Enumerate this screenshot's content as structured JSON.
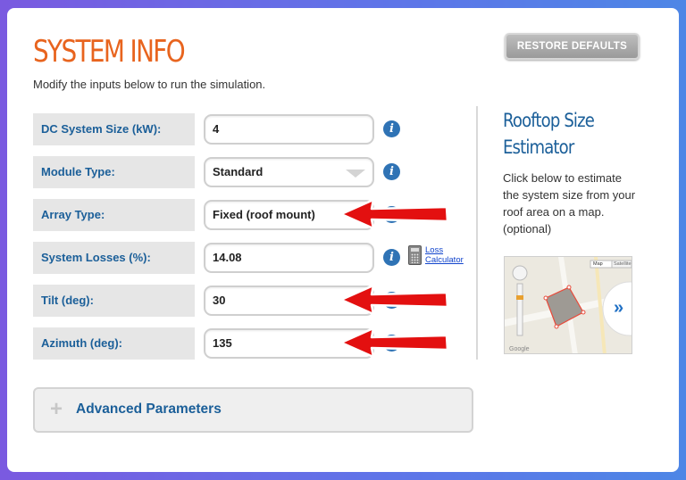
{
  "header": {
    "title": "SYSTEM INFO",
    "subtitle": "Modify the inputs below to run the simulation.",
    "restore_label": "RESTORE DEFAULTS"
  },
  "form": {
    "system_size": {
      "label": "DC System Size (kW):",
      "value": "4"
    },
    "module_type": {
      "label": "Module Type:",
      "value": "Standard"
    },
    "array_type": {
      "label": "Array Type:",
      "value": "Fixed (roof mount)"
    },
    "system_losses": {
      "label": "System Losses (%):",
      "value": "14.08",
      "link_line1": "Loss",
      "link_line2": "Calculator"
    },
    "tilt": {
      "label": "Tilt (deg):",
      "value": "30"
    },
    "azimuth": {
      "label": "Azimuth (deg):",
      "value": "135"
    }
  },
  "sidebar": {
    "title_line1": "Rooftop Size",
    "title_line2": "Estimator",
    "description": "Click below to estimate the system size from your roof area on a map. (optional)",
    "map_type_map": "Map",
    "map_type_satellite": "Satellite",
    "map_attribution": "Google"
  },
  "advanced": {
    "plus": "+",
    "label": "Advanced Parameters"
  },
  "colors": {
    "title_orange": "#e8641e",
    "label_blue": "#1b5f99",
    "info_blue": "#2f73b5",
    "annotation_red": "#e31010"
  },
  "icons": {
    "info": "info-icon",
    "calculator": "calculator-icon",
    "arrow": "red-arrow-annotation",
    "map_next": "double-chevron-right-icon"
  }
}
